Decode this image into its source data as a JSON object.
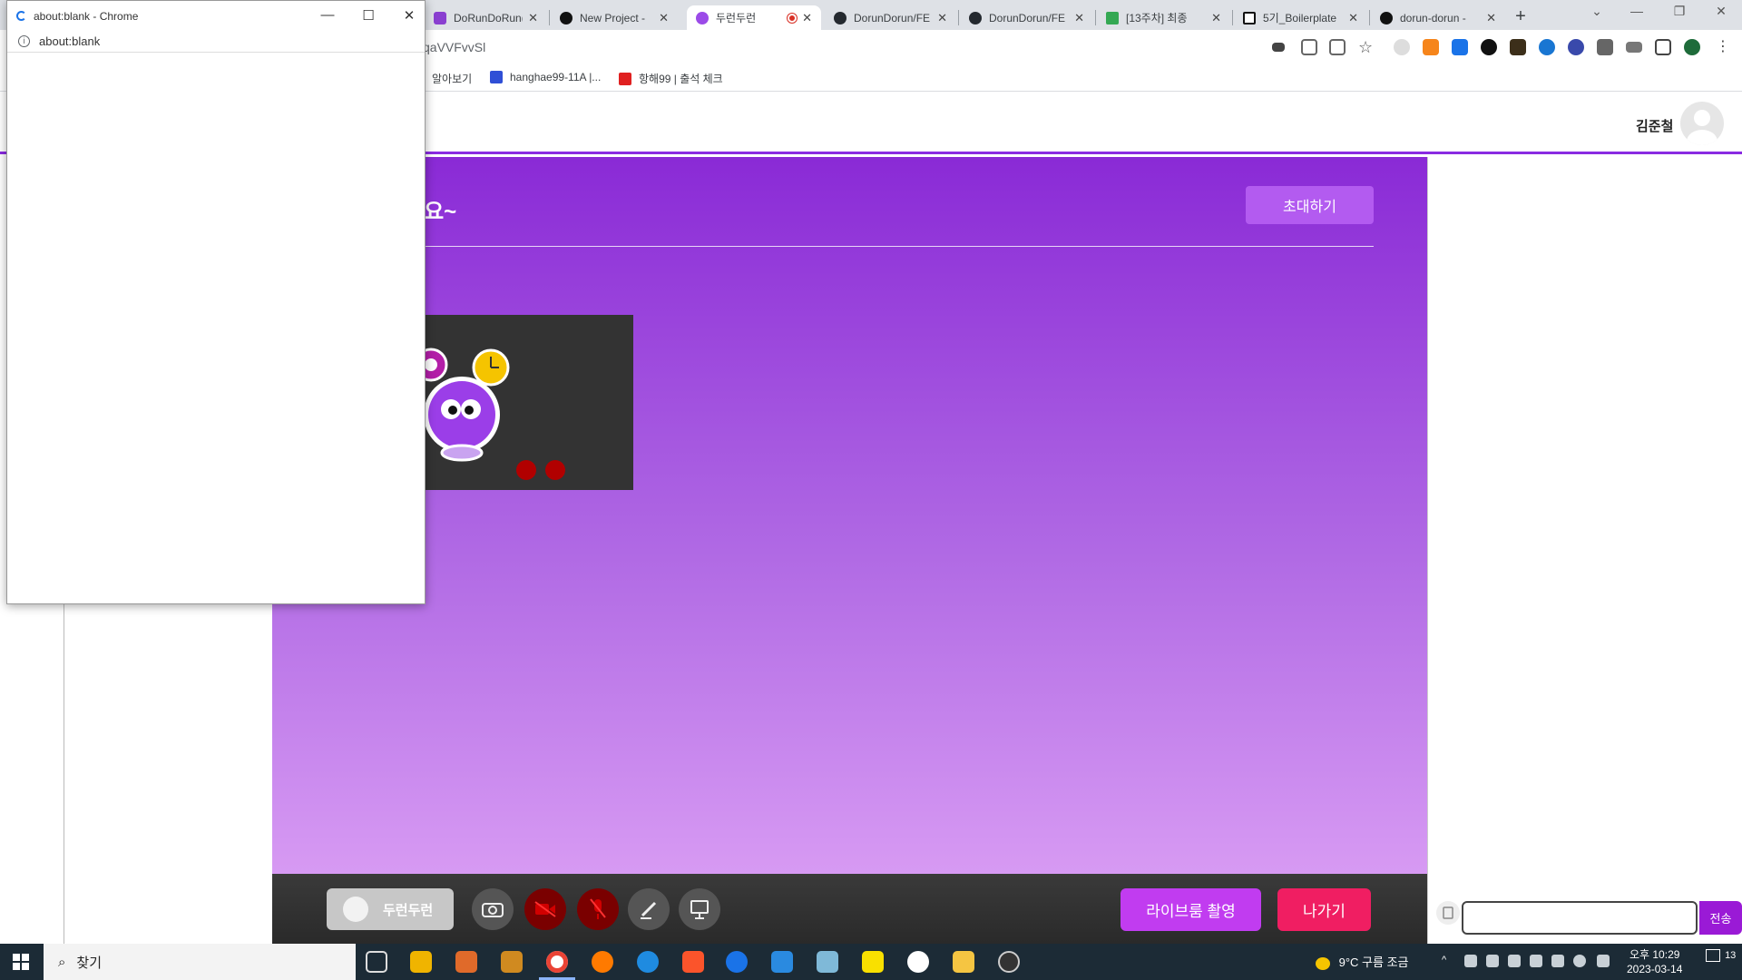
{
  "browser": {
    "tabs": [
      {
        "label": "DoRunDoRun(ㅍ",
        "active": false
      },
      {
        "label": "New Project - ",
        "active": false
      },
      {
        "label": "두런두런",
        "active": true
      },
      {
        "label": "DorunDorun/FE",
        "active": false
      },
      {
        "label": "DorunDorun/FE",
        "active": false
      },
      {
        "label": "[13주차] 최종 ",
        "active": false
      },
      {
        "label": "5기_Boilerplate",
        "active": false
      },
      {
        "label": "dorun-dorun -",
        "active": false
      }
    ],
    "new_tab": "+",
    "url": "qaVVFvvSl",
    "bookmarks": [
      "알아보기",
      "hanghae99-11A |...",
      "항해99 | 출석 체크"
    ]
  },
  "popup": {
    "title": "about:blank - Chrome",
    "url": "about:blank"
  },
  "app": {
    "user_name": "김준철",
    "room_title": "해요~",
    "invite_label": "초대하기",
    "participant_name": "두런두런",
    "record_label": "라이브룸 촬영",
    "leave_label": "나가기",
    "chat_send_label": "전송",
    "chat_placeholder": ""
  },
  "taskbar": {
    "search_label": "찾기",
    "weather": "9°C  구름 조금",
    "time": "오후 10:29",
    "date": "2023-03-14",
    "notification_count": "13"
  },
  "colors": {
    "accent": "#8a2be2",
    "invite": "#b35bf0",
    "record": "#c13cf0",
    "leave": "#f01e62",
    "muted": "#b10000"
  }
}
